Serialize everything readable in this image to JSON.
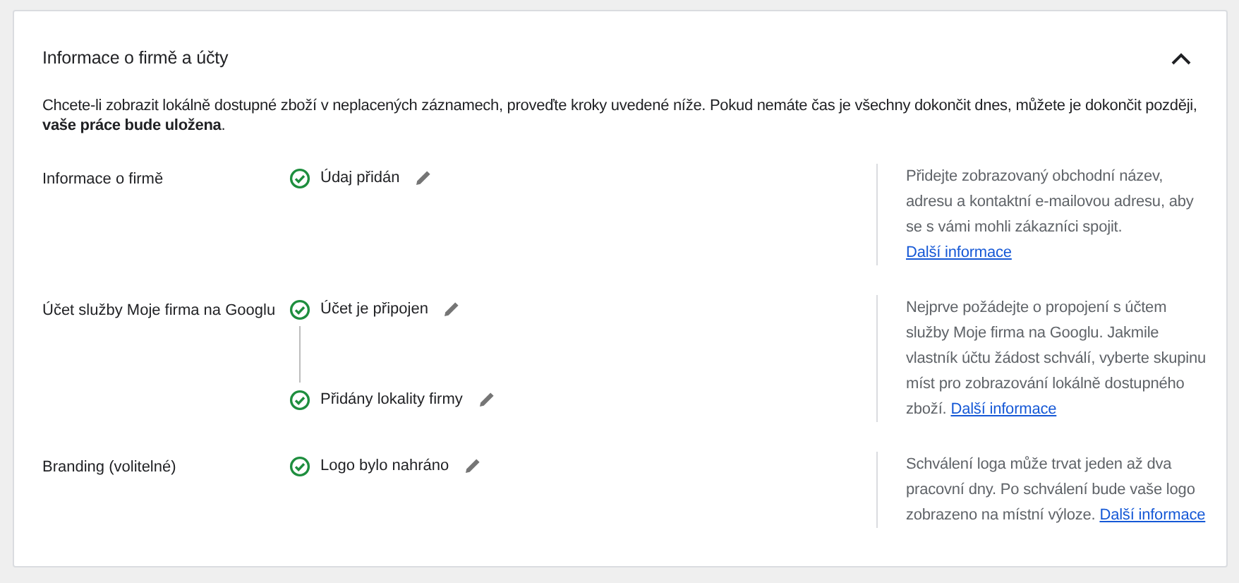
{
  "section": {
    "title": "Informace o firmě a účty",
    "expanded": true,
    "intro": "Chcete-li zobrazit lokálně dostupné zboží v neplacených záznamech, proveďte kroky uvedené níže. Pokud nemáte čas je všechny dokončit dnes, můžete je dokončit později, **vaše práce bude uložena**.",
    "rows": [
      {
        "label": "Informace o firmě",
        "steps": [
          {
            "text": "Údaj přidán",
            "completed": true
          }
        ],
        "help": "Přidejte zobrazovaný obchodní název, adresu a kontaktní e-mailovou adresu, aby se s vámi mohli zákazníci spojit.",
        "link": "Další informace"
      },
      {
        "label": "Účet služby Moje firma na Googlu",
        "steps": [
          {
            "text": "Účet je připojen",
            "completed": true
          },
          {
            "text": "Přidány lokality firmy",
            "completed": true
          }
        ],
        "help": "Nejprve požádejte o propojení s účtem služby Moje firma na Googlu. Jakmile vlastník účtu žádost schválí, vyberte skupinu míst pro zobrazování lokálně dostupného zboží.",
        "link": "Další informace"
      },
      {
        "label": "Branding (volitelné)",
        "steps": [
          {
            "text": "Logo bylo nahráno",
            "completed": true
          }
        ],
        "help": "Schválení loga může trvat jeden až dva pracovní dny. Po schválení bude vaše logo zobrazeno na místní výloze.",
        "link": "Další informace"
      }
    ]
  }
}
